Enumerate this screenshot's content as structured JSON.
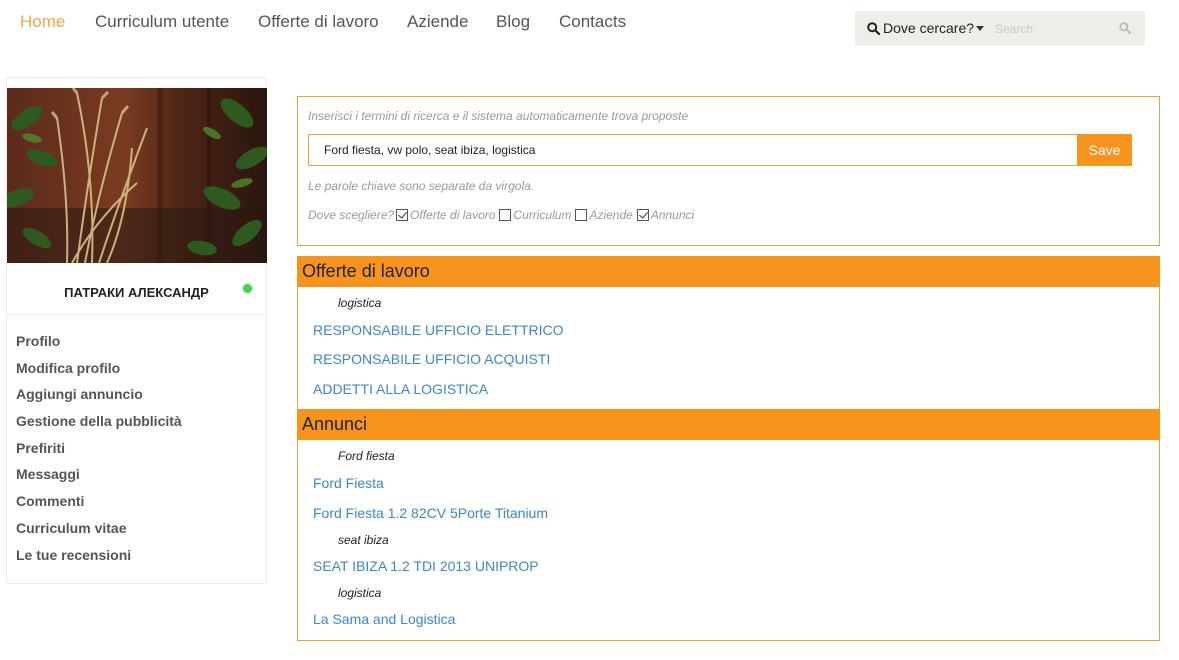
{
  "nav": {
    "items": [
      {
        "label": "Home",
        "active": true
      },
      {
        "label": "Curriculum utente",
        "active": false
      },
      {
        "label": "Offerte di lavoro",
        "active": false
      },
      {
        "label": "Aziende",
        "active": false
      },
      {
        "label": "Blog",
        "active": false
      },
      {
        "label": "Contacts",
        "active": false
      }
    ],
    "where_label": "Dove cercare?",
    "search_placeholder": "Search"
  },
  "sidebar": {
    "user_name": "ПАТРАКИ АЛЕКСАНДР",
    "status": "online",
    "menu": [
      "Profilo",
      "Modifica profilo",
      "Aggiungi annuncio",
      "Gestione della pubblicità",
      "Prefiriti",
      "Messaggi",
      "Commenti",
      "Curriculum vitae",
      "Le tue recensioni"
    ]
  },
  "search_panel": {
    "hint": "Inserisci i termini di ricerca e il sistema automaticamente trova proposte",
    "keywords_value": "Ford fiesta, vw polo, seat ibiza, logistica",
    "save_label": "Save",
    "keywords_note": "Le parole chiave sono separate da virgola.",
    "scope_label": "Dove scegliere?",
    "scope_options": [
      {
        "label": "Offerte di lavoro",
        "checked": true
      },
      {
        "label": "Curriculum",
        "checked": false
      },
      {
        "label": "Aziende",
        "checked": false
      },
      {
        "label": "Annunci",
        "checked": true
      }
    ]
  },
  "results": {
    "jobs": {
      "title": "Offerte di lavoro",
      "term": "logistica",
      "links": [
        "RESPONSABILE UFFICIO ELETTRICO",
        "RESPONSABILE UFFICIO ACQUISTI",
        "ADDETTI ALLA LOGISTICA"
      ]
    },
    "ads": {
      "title": "Annunci",
      "groups": [
        {
          "term": "Ford fiesta",
          "links": [
            "Ford Fiesta",
            "Ford Fiesta 1.2 82CV 5Porte Titanium"
          ]
        },
        {
          "term": "seat ibiza",
          "links": [
            "SEAT IBIZA 1.2 TDI 2013 UNIPROP"
          ]
        },
        {
          "term": "logistica",
          "links": [
            "La Sama and Logistica"
          ]
        }
      ]
    }
  },
  "colors": {
    "accent": "#f7941d",
    "active_nav": "#f7a34a",
    "link": "#3f86c9",
    "online": "#4cd14c"
  }
}
